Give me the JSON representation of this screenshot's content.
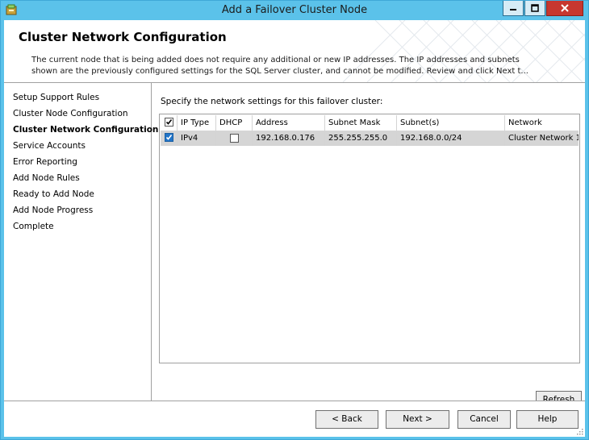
{
  "window": {
    "title": "Add a Failover Cluster Node"
  },
  "header": {
    "title": "Cluster Network Configuration",
    "description": "The current node that is being added does not require any additional or new IP addresses.  The IP addresses and subnets shown are the previously configured settings for the SQL Server cluster, and cannot be modified. Review and click Next t..."
  },
  "nav": {
    "items": [
      {
        "label": "Setup Support Rules",
        "active": false
      },
      {
        "label": "Cluster Node Configuration",
        "active": false
      },
      {
        "label": "Cluster Network Configuration",
        "active": true
      },
      {
        "label": "Service Accounts",
        "active": false
      },
      {
        "label": "Error Reporting",
        "active": false
      },
      {
        "label": "Add Node Rules",
        "active": false
      },
      {
        "label": "Ready to Add Node",
        "active": false
      },
      {
        "label": "Add Node Progress",
        "active": false
      },
      {
        "label": "Complete",
        "active": false
      }
    ]
  },
  "main": {
    "instruction": "Specify the network settings for this failover cluster:",
    "columns": [
      "IP Type",
      "DHCP",
      "Address",
      "Subnet Mask",
      "Subnet(s)",
      "Network"
    ],
    "rows": [
      {
        "checked": true,
        "ip_type": "IPv4",
        "dhcp": false,
        "address": "192.168.0.176",
        "subnet_mask": "255.255.255.0",
        "subnets": "192.168.0.0/24",
        "network": "Cluster Network 1"
      }
    ],
    "refresh_label": "Refresh"
  },
  "footer": {
    "back_label": "< Back",
    "next_label": "Next >",
    "cancel_label": "Cancel",
    "help_label": "Help"
  },
  "colors": {
    "titlebar": "#5bc2ea",
    "close_button": "#c7372f",
    "checkbox_checked": "#2275c8",
    "selected_row": "#d5d5d5"
  }
}
